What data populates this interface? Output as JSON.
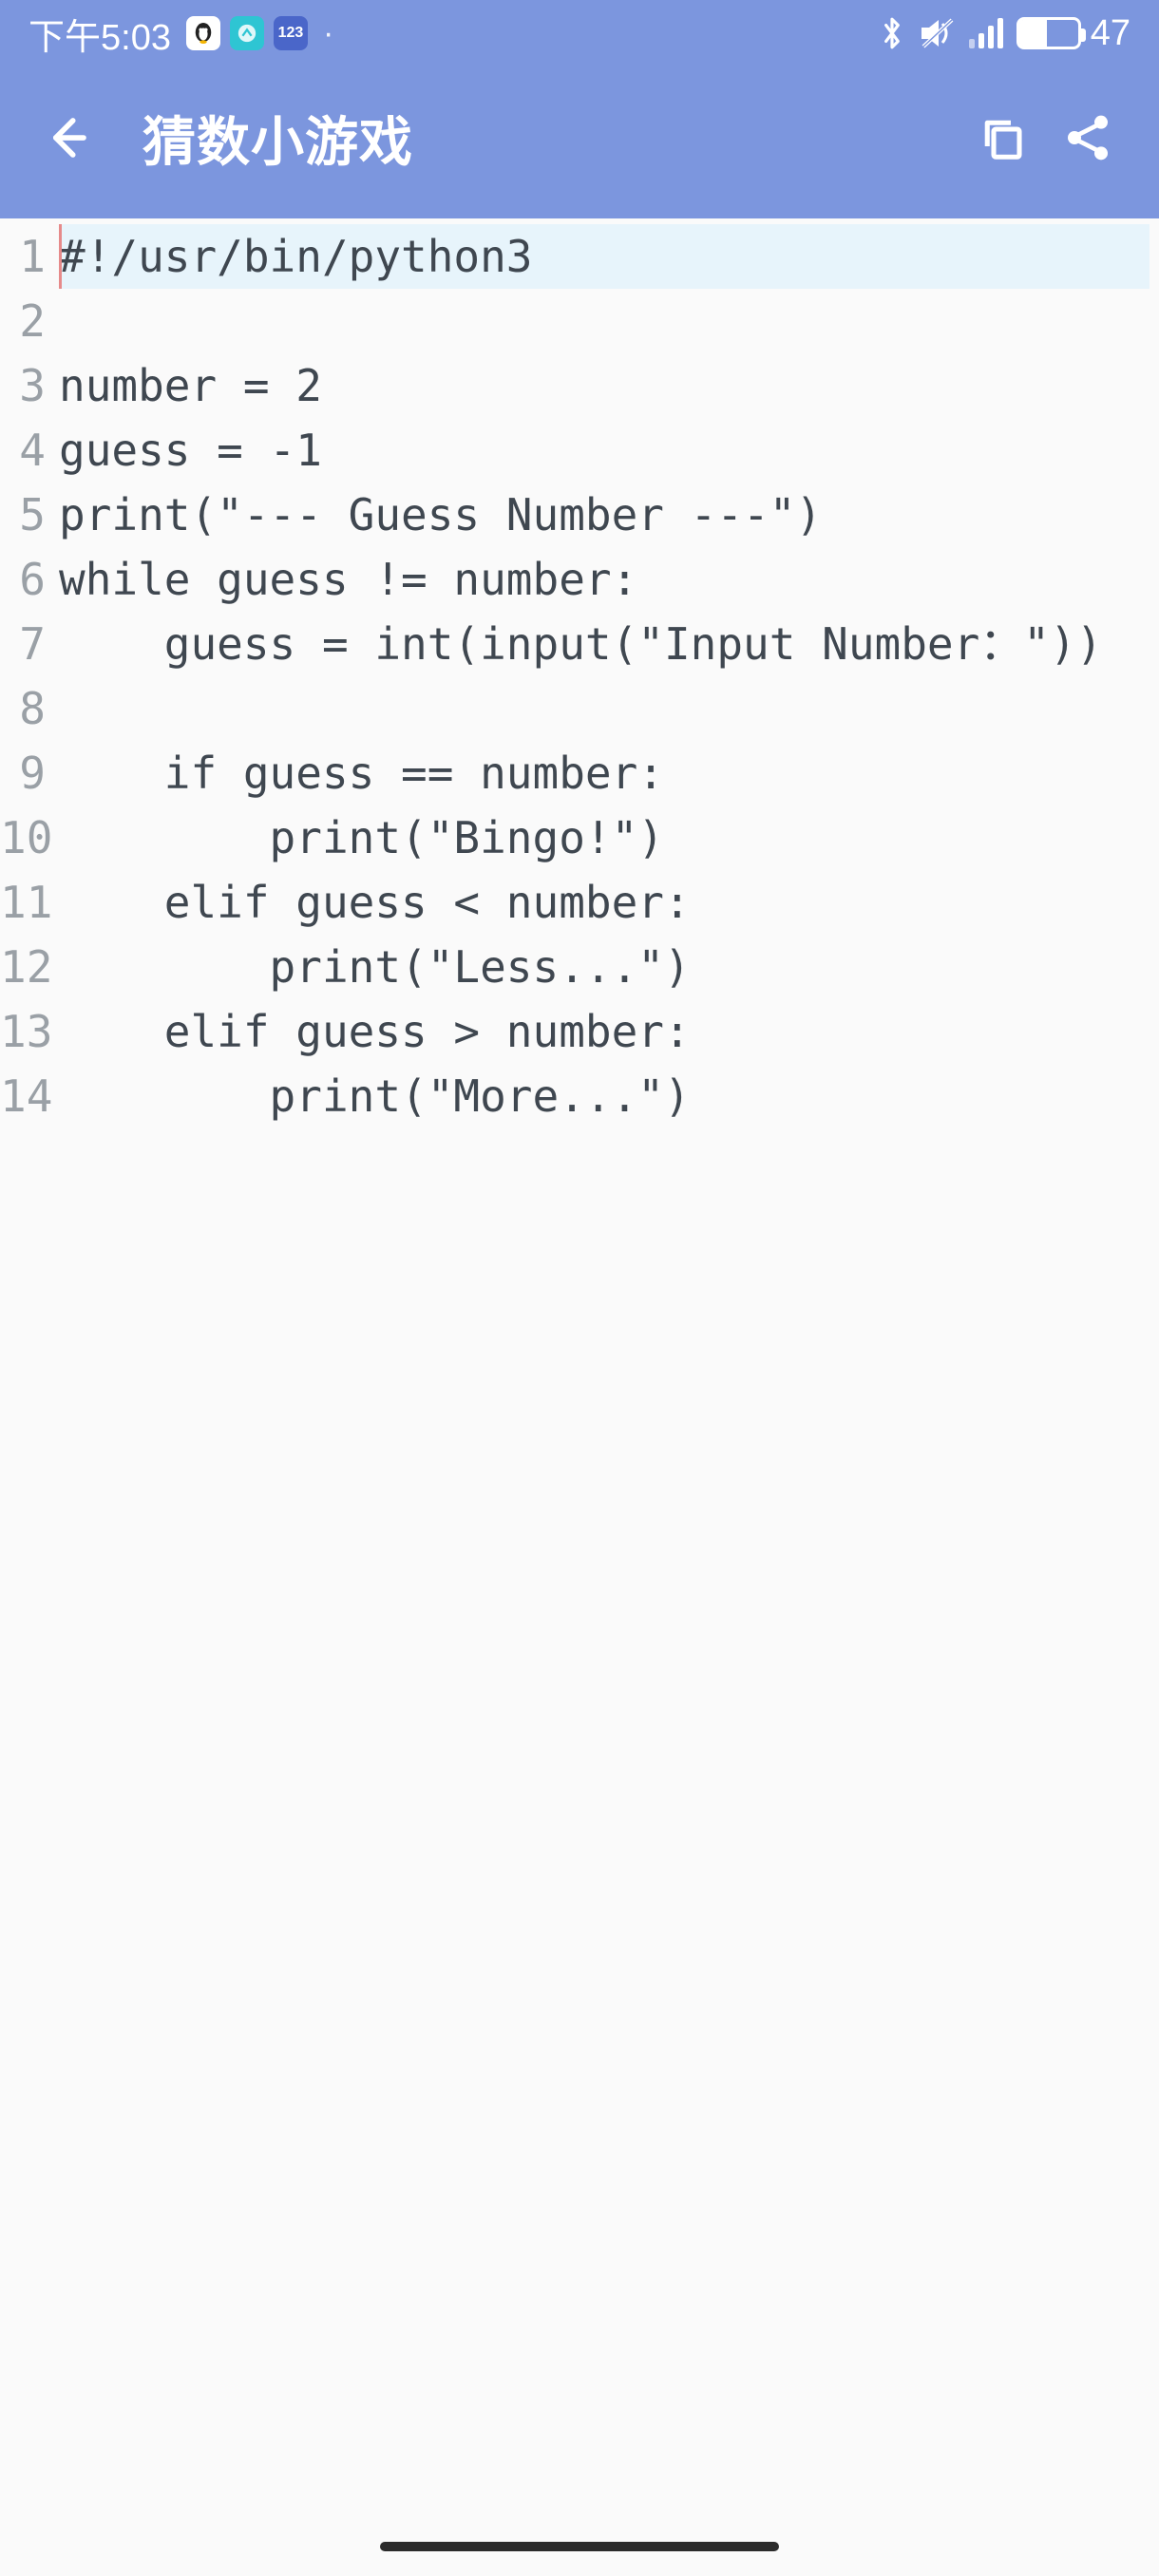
{
  "status": {
    "time": "下午5:03",
    "badge_count": "123",
    "battery_percent": "47"
  },
  "appbar": {
    "title": "猜数小游戏"
  },
  "code": {
    "highlighted_line": 1,
    "lines": [
      "#!/usr/bin/python3",
      "",
      "number = 2",
      "guess = -1",
      "print(\"--- Guess Number ---\")",
      "while guess != number:",
      "    guess = int(input(\"Input Number：\"))",
      "",
      "    if guess == number:",
      "        print(\"Bingo!\")",
      "    elif guess < number:",
      "        print(\"Less...\")",
      "    elif guess > number:",
      "        print(\"More...\")"
    ]
  }
}
